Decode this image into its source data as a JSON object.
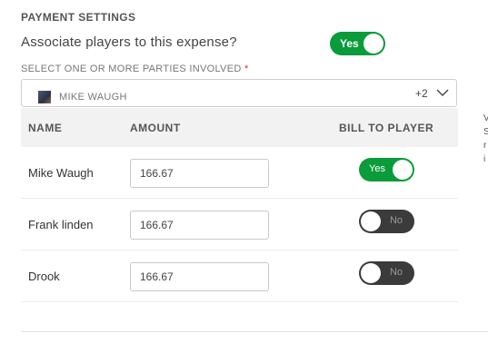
{
  "section": {
    "title": "PAYMENT SETTINGS"
  },
  "associate": {
    "label": "Associate players to this expense?",
    "toggle_label": "Yes",
    "toggle_state": "on"
  },
  "parties": {
    "label": "SELECT ONE OR MORE PARTIES INVOLVED",
    "required_mark": "*",
    "selected_name": "MIKE WAUGH",
    "more_count": "+2"
  },
  "table": {
    "headers": {
      "name": "NAME",
      "amount": "AMOUNT",
      "bill": "BILL TO PLAYER"
    },
    "rows": [
      {
        "name": "Mike Waugh",
        "amount": "166.67",
        "bill_label": "Yes",
        "bill_state": "on"
      },
      {
        "name": "Frank linden",
        "amount": "166.67",
        "bill_label": "No",
        "bill_state": "off"
      },
      {
        "name": "Drook",
        "amount": "166.67",
        "bill_label": "No",
        "bill_state": "off"
      }
    ]
  },
  "side_text_fragments": [
    "V",
    "S",
    "r",
    "i"
  ],
  "colors": {
    "toggle_on": "#0a9b3a",
    "toggle_off": "#3b3b3b",
    "required": "#d0303a"
  }
}
